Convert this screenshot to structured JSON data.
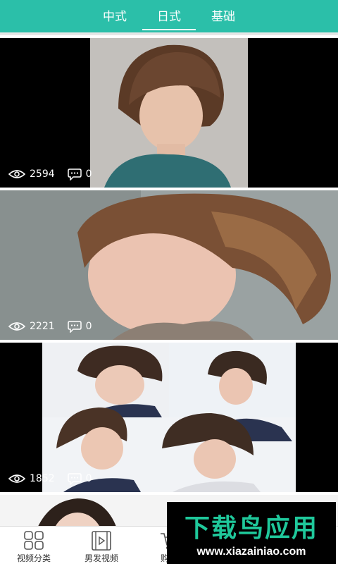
{
  "tabs": [
    {
      "label": "中式"
    },
    {
      "label": "日式",
      "active": true
    },
    {
      "label": "基础"
    }
  ],
  "feed": [
    {
      "views": "2594",
      "comments": "0"
    },
    {
      "views": "2221",
      "comments": "0"
    },
    {
      "views": "1852",
      "comments": "0"
    },
    {}
  ],
  "bottom_nav": [
    {
      "label": "视频分类",
      "icon": "grid-icon"
    },
    {
      "label": "男发视频",
      "icon": "film-icon"
    },
    {
      "label": "购买",
      "icon": "cart-icon"
    }
  ],
  "watermark": {
    "title": "下载鸟应用",
    "url": "www.xiazainiao.com"
  },
  "colors": {
    "accent": "#2bbfa9",
    "watermark_green": "#1fc89b"
  }
}
